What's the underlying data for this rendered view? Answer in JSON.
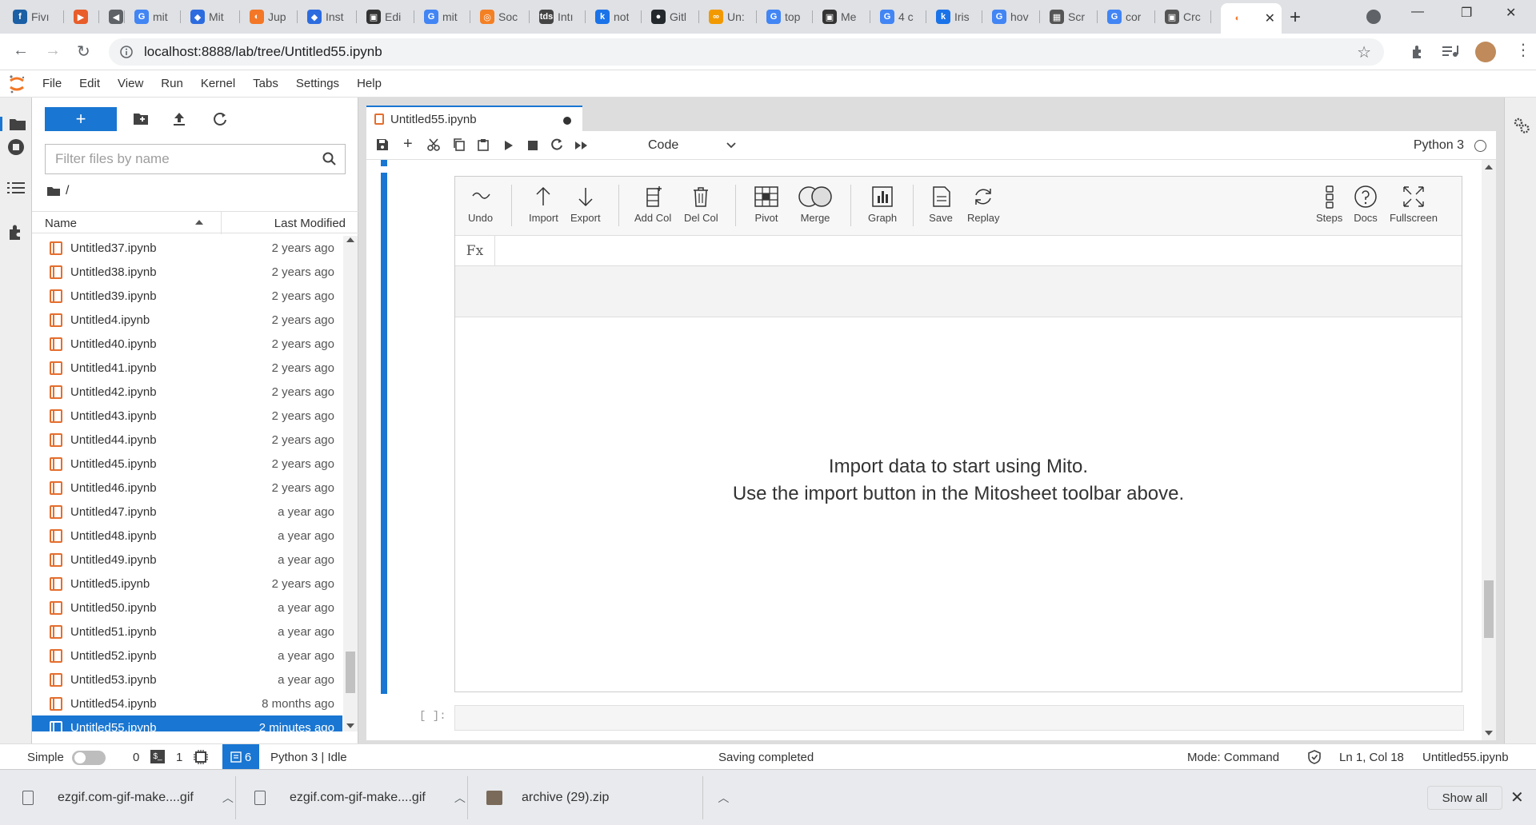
{
  "browser": {
    "tabs": [
      {
        "label": "Fivı",
        "color": "#1b5fa5",
        "glyph": "f"
      },
      {
        "label": "",
        "color": "#e85d2a",
        "glyph": "▶"
      },
      {
        "label": "",
        "color": "#5f6368",
        "glyph": "◀"
      },
      {
        "label": "mit",
        "color": "#4285f4",
        "glyph": "G"
      },
      {
        "label": "Mit",
        "color": "#2d6cdf",
        "glyph": "◆"
      },
      {
        "label": "Jup",
        "color": "#f37726",
        "glyph": "◐"
      },
      {
        "label": "Inst",
        "color": "#2d6cdf",
        "glyph": "◆"
      },
      {
        "label": "Edi",
        "color": "#333333",
        "glyph": "▣"
      },
      {
        "label": "mit",
        "color": "#4285f4",
        "glyph": "G"
      },
      {
        "label": "Soc",
        "color": "#f48024",
        "glyph": "◎"
      },
      {
        "label": "Intı",
        "color": "#444444",
        "glyph": "tds"
      },
      {
        "label": "not",
        "color": "#1a73e8",
        "glyph": "k"
      },
      {
        "label": "Gitl",
        "color": "#24292e",
        "glyph": "●"
      },
      {
        "label": "Un:",
        "color": "#f29900",
        "glyph": "∞"
      },
      {
        "label": "top",
        "color": "#4285f4",
        "glyph": "G"
      },
      {
        "label": "Me",
        "color": "#333333",
        "glyph": "▣"
      },
      {
        "label": "4 c",
        "color": "#4285f4",
        "glyph": "G"
      },
      {
        "label": "Iris",
        "color": "#1a73e8",
        "glyph": "k"
      },
      {
        "label": "hov",
        "color": "#4285f4",
        "glyph": "G"
      },
      {
        "label": "Scr",
        "color": "#555555",
        "glyph": "▦"
      },
      {
        "label": "cor",
        "color": "#4285f4",
        "glyph": "G"
      },
      {
        "label": "Crc",
        "color": "#555555",
        "glyph": "▣"
      },
      {
        "label": "",
        "color": "#f37726",
        "glyph": "◐",
        "active": true
      }
    ],
    "url": "localhost:8888/lab/tree/Untitled55.ipynb"
  },
  "menu": [
    "File",
    "Edit",
    "View",
    "Run",
    "Kernel",
    "Tabs",
    "Settings",
    "Help"
  ],
  "filebrowser": {
    "new_label": "+",
    "filter_placeholder": "Filter files by name",
    "breadcrumb": "/",
    "col_name": "Name",
    "col_modified": "Last Modified",
    "files": [
      {
        "name": "Untitled37.ipynb",
        "modified": "2 years ago"
      },
      {
        "name": "Untitled38.ipynb",
        "modified": "2 years ago"
      },
      {
        "name": "Untitled39.ipynb",
        "modified": "2 years ago"
      },
      {
        "name": "Untitled4.ipynb",
        "modified": "2 years ago"
      },
      {
        "name": "Untitled40.ipynb",
        "modified": "2 years ago"
      },
      {
        "name": "Untitled41.ipynb",
        "modified": "2 years ago"
      },
      {
        "name": "Untitled42.ipynb",
        "modified": "2 years ago"
      },
      {
        "name": "Untitled43.ipynb",
        "modified": "2 years ago"
      },
      {
        "name": "Untitled44.ipynb",
        "modified": "2 years ago"
      },
      {
        "name": "Untitled45.ipynb",
        "modified": "2 years ago"
      },
      {
        "name": "Untitled46.ipynb",
        "modified": "2 years ago"
      },
      {
        "name": "Untitled47.ipynb",
        "modified": "a year ago"
      },
      {
        "name": "Untitled48.ipynb",
        "modified": "a year ago"
      },
      {
        "name": "Untitled49.ipynb",
        "modified": "a year ago"
      },
      {
        "name": "Untitled5.ipynb",
        "modified": "2 years ago"
      },
      {
        "name": "Untitled50.ipynb",
        "modified": "a year ago"
      },
      {
        "name": "Untitled51.ipynb",
        "modified": "a year ago"
      },
      {
        "name": "Untitled52.ipynb",
        "modified": "a year ago"
      },
      {
        "name": "Untitled53.ipynb",
        "modified": "a year ago"
      },
      {
        "name": "Untitled54.ipynb",
        "modified": "8 months ago"
      },
      {
        "name": "Untitled55.ipynb",
        "modified": "2 minutes ago",
        "selected": true
      }
    ]
  },
  "notebook": {
    "tab_title": "Untitled55.ipynb",
    "cell_type": "Code",
    "kernel": "Python 3",
    "next_prompt": "[ ]:"
  },
  "mito": {
    "buttons": [
      {
        "label": "Undo",
        "icon": "undo-icon"
      },
      {
        "label": "Import",
        "icon": "import-icon"
      },
      {
        "label": "Export",
        "icon": "export-icon"
      },
      {
        "label": "Add Col",
        "icon": "add-column-icon"
      },
      {
        "label": "Del Col",
        "icon": "delete-column-icon"
      },
      {
        "label": "Pivot",
        "icon": "pivot-icon"
      },
      {
        "label": "Merge",
        "icon": "merge-icon"
      },
      {
        "label": "Graph",
        "icon": "graph-icon"
      },
      {
        "label": "Save",
        "icon": "save-icon"
      },
      {
        "label": "Replay",
        "icon": "replay-icon"
      },
      {
        "label": "Steps",
        "icon": "steps-icon"
      },
      {
        "label": "Docs",
        "icon": "docs-icon"
      },
      {
        "label": "Fullscreen",
        "icon": "fullscreen-icon"
      }
    ],
    "fx_label": "Fx",
    "message_line1": "Import data to start using Mito.",
    "message_line2": "Use the import button in the Mitosheet toolbar above."
  },
  "status": {
    "mode_label": "Simple",
    "terminals": "0",
    "kernels": "1",
    "notebook_count": "6",
    "kernel_status": "Python 3 | Idle",
    "message": "Saving completed",
    "mode": "Mode: Command",
    "cursor": "Ln 1, Col 18",
    "file": "Untitled55.ipynb"
  },
  "downloads": {
    "items": [
      "ezgif.com-gif-make....gif",
      "ezgif.com-gif-make....gif",
      "archive (29).zip"
    ],
    "show_all": "Show all"
  },
  "colors": {
    "accent": "#1976d2",
    "notebook_icon": "#e46e2e",
    "jupyter_orange": "#f37726"
  }
}
